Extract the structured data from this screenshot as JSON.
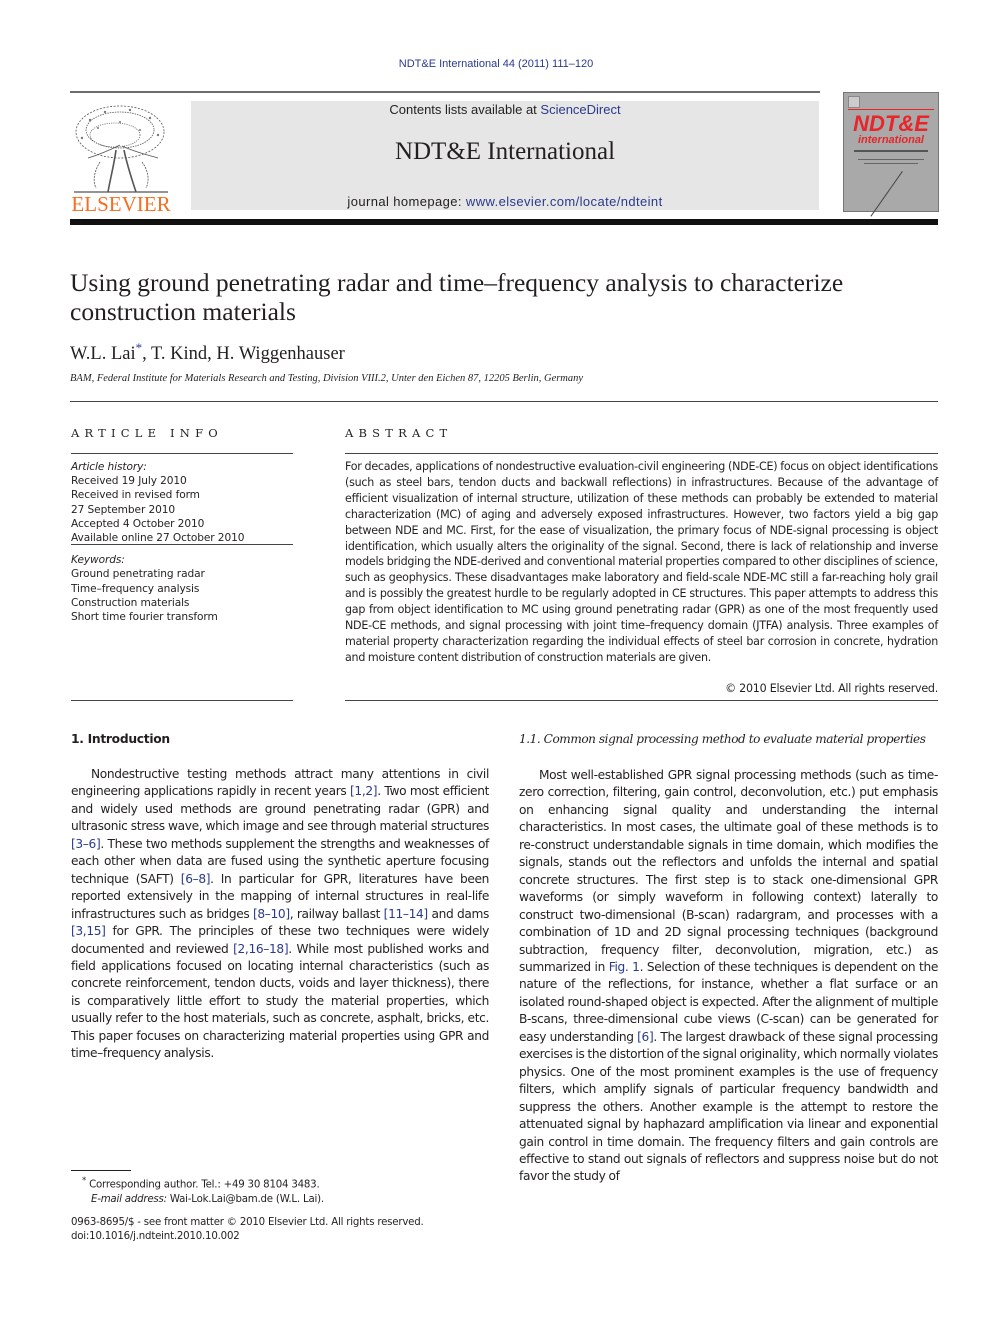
{
  "header": {
    "running_head": "NDT&E International 44 (2011) 111–120",
    "contents_prefix": "Contents lists available at ",
    "contents_link": "ScienceDirect",
    "journal_title": "NDT&E International",
    "homepage_prefix": "journal homepage: ",
    "homepage_link": "www.elsevier.com/locate/ndteint",
    "publisher_logo_text": "ELSEVIER",
    "cover_title": "NDT&E",
    "cover_subtitle": "international",
    "colors": {
      "link": "#2a3a8c",
      "publisher_orange": "#f36f21",
      "masthead_bg": "#e6e6e6",
      "cover_red": "#e8252b"
    }
  },
  "article": {
    "title": "Using ground penetrating radar and time–frequency analysis to characterize construction materials",
    "authors": [
      {
        "name": "W.L. Lai",
        "mark": "*"
      },
      {
        "name": "T. Kind",
        "mark": ""
      },
      {
        "name": "H. Wiggenhauser",
        "mark": ""
      }
    ],
    "authors_display_1": "W.L. Lai",
    "authors_mark": "*",
    "authors_display_2": ", T. Kind, H. Wiggenhauser",
    "affiliation": "BAM, Federal Institute for Materials Research and Testing, Division VIII.2, Unter den Eichen 87, 12205 Berlin, Germany"
  },
  "article_info": {
    "heading": "ARTICLE INFO",
    "history_label": "Article history:",
    "history": [
      "Received 19 July 2010",
      "Received in revised form",
      "27 September 2010",
      "Accepted 4 October 2010",
      "Available online 27 October 2010"
    ],
    "keywords_label": "Keywords:",
    "keywords": [
      "Ground penetrating radar",
      "Time–frequency analysis",
      "Construction materials",
      "Short time fourier transform"
    ]
  },
  "abstract": {
    "heading": "ABSTRACT",
    "text": "For decades, applications of nondestructive evaluation-civil engineering (NDE-CE) focus on object identifications (such as steel bars, tendon ducts and backwall reflections) in infrastructures. Because of the advantage of efficient visualization of internal structure, utilization of these methods can probably be extended to material characterization (MC) of aging and adversely exposed infrastructures. However, two factors yield a big gap between NDE and MC. First, for the ease of visualization, the primary focus of NDE-signal processing is object identification, which usually alters the originality of the signal. Second, there is lack of relationship and inverse models bridging the NDE-derived and conventional material properties compared to other disciplines of science, such as geophysics. These disadvantages make laboratory and field-scale NDE-MC still a far-reaching holy grail and is possibly the greatest hurdle to be regularly adopted in CE structures. This paper attempts to address this gap from object identification to MC using ground penetrating radar (GPR) as one of the most frequently used NDE-CE methods, and signal processing with joint time–frequency domain (JTFA) analysis. Three examples of material property characterization regarding the individual effects of steel bar corrosion in concrete, hydration and moisture content distribution of construction materials are given.",
    "copyright": "© 2010 Elsevier Ltd. All rights reserved."
  },
  "introduction": {
    "heading": "1.  Introduction",
    "segments": [
      {
        "t": "Nondestructive testing methods attract many attentions in civil engineering applications rapidly in recent years "
      },
      {
        "ref": "[1,2]"
      },
      {
        "t": ". Two most efficient and widely used methods are ground penetrating radar (GPR) and ultrasonic stress wave, which image and see through material structures "
      },
      {
        "ref": "[3–6]"
      },
      {
        "t": ". These two methods supplement the strengths and weaknesses of each other when data are fused using the synthetic aperture focusing technique (SAFT) "
      },
      {
        "ref": "[6–8]"
      },
      {
        "t": ". In particular for GPR, literatures have been reported extensively in the mapping of internal structures in real-life infrastructures such as bridges "
      },
      {
        "ref": "[8–10]"
      },
      {
        "t": ", railway ballast "
      },
      {
        "ref": "[11–14]"
      },
      {
        "t": " and dams "
      },
      {
        "ref": "[3,15]"
      },
      {
        "t": " for GPR. The principles of these two techniques were widely documented and reviewed "
      },
      {
        "ref": "[2,16–18]"
      },
      {
        "t": ". While most published works and field applications focused on locating internal characteristics (such as concrete reinforcement, tendon ducts, voids and layer thickness), there is comparatively little effort to study the material properties, which usually refer to the host materials, such as concrete, asphalt, bricks, etc. This paper focuses on characterizing material properties using GPR and time–frequency analysis."
      }
    ]
  },
  "section_1_1": {
    "heading": "1.1.   Common signal processing method to evaluate material properties",
    "segments": [
      {
        "t": "Most well-established GPR signal processing methods (such as time-zero correction, filtering, gain control, deconvolution, etc.) put emphasis on enhancing signal quality and understanding the internal characteristics. In most cases, the ultimate goal of these methods is to re-construct understandable signals in time domain, which modifies the signals, stands out the reflectors and unfolds the internal and spatial concrete structures. The first step is to stack one-dimensional GPR waveforms (or simply waveform in following context) laterally to construct two-dimensional (B-scan) radargram, and processes with a combination of 1D and 2D signal processing techniques (background subtraction, frequency filter, deconvolution, migration, etc.) as summarized in "
      },
      {
        "ref": "Fig. 1"
      },
      {
        "t": ". Selection of these techniques is dependent on the nature of the reflections, for instance, whether a flat surface or an isolated round-shaped object is expected. After the alignment of multiple B-scans, three-dimensional cube views (C-scan) can be generated for easy understanding "
      },
      {
        "ref": "[6]"
      },
      {
        "t": ". The largest drawback of these signal processing exercises is the distortion of the signal originality, which normally violates physics. One of the most prominent examples is the use of frequency filters, which amplify signals of particular frequency bandwidth and suppress the others. Another example is the attempt to restore the attenuated signal by haphazard amplification via linear and exponential gain control in time domain. The frequency filters and gain controls are effective to stand out signals of reflectors and suppress noise but do not favor the study of"
      }
    ]
  },
  "footnote": {
    "mark": "*",
    "corresponding": " Corresponding author. Tel.: +49 30 8104 3483.",
    "email_label": "E-mail address:",
    "email_value": " Wai-Lok.Lai@bam.de (W.L. Lai)."
  },
  "front_matter": {
    "issn_line": "0963-8695/$ - see front matter © 2010 Elsevier Ltd. All rights reserved.",
    "doi": "doi:10.1016/j.ndteint.2010.10.002"
  }
}
